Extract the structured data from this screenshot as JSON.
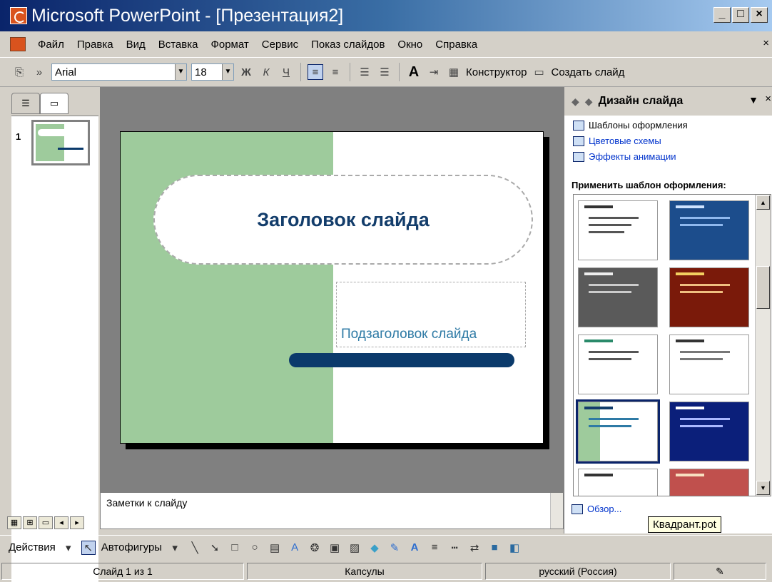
{
  "window": {
    "title": "Microsoft PowerPoint - [Презентация2]",
    "buttons": [
      "_",
      "□",
      "×"
    ]
  },
  "menu": {
    "items": [
      "Файл",
      "Правка",
      "Вид",
      "Вставка",
      "Формат",
      "Сервис",
      "Показ слайдов",
      "Окно",
      "Справка"
    ],
    "close": "×"
  },
  "toolbar": {
    "font": "Arial",
    "size": "18",
    "bold": "Ж",
    "italic": "К",
    "underline": "Ч",
    "shadow": "A",
    "designer": "Конструктор",
    "new_slide": "Создать слайд"
  },
  "slides_pane": {
    "slide_number": "1"
  },
  "slide": {
    "title": "Заголовок слайда",
    "subtitle": "Подзаголовок слайда"
  },
  "notes": {
    "placeholder": "Заметки к слайду"
  },
  "task_pane": {
    "title": "Дизайн слайда",
    "links": [
      "Шаблоны оформления",
      "Цветовые схемы",
      "Эффекты анимации"
    ],
    "apply_label": "Применить шаблон оформления:",
    "browse": "Обзор..."
  },
  "tooltip": "Квадрант.pot",
  "draw": {
    "actions": "Действия",
    "autoshapes": "Автофигуры"
  },
  "status": {
    "slide": "Слайд 1 из 1",
    "design": "Капсулы",
    "language": "русский (Россия)"
  },
  "colors": {
    "slide_green": "#9ecb9c",
    "title_text": "#133d6b",
    "subtitle_text": "#2e7aa5",
    "accent_bar": "#0b3a6b"
  }
}
